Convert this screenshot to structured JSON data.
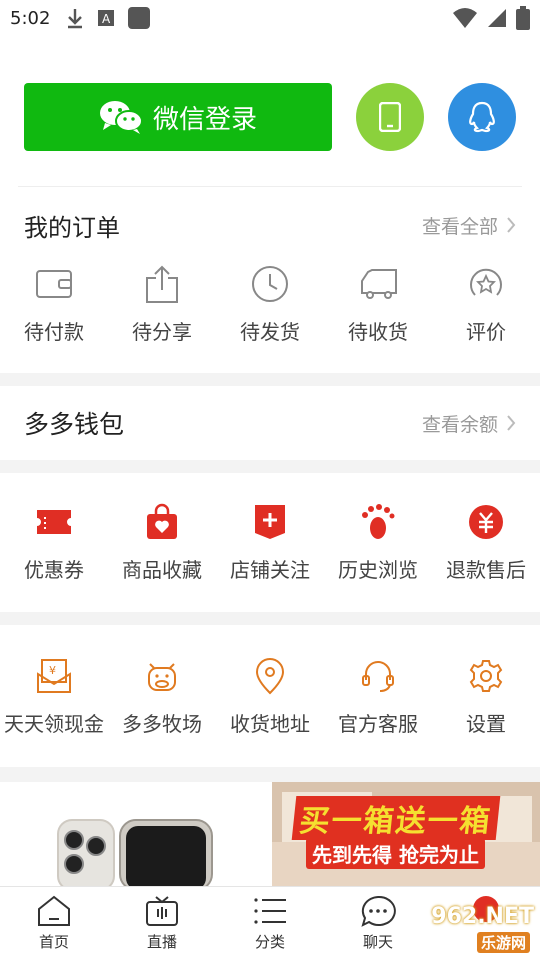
{
  "status": {
    "time": "5:02"
  },
  "login": {
    "wechat_label": "微信登录"
  },
  "orders": {
    "title": "我的订单",
    "link": "查看全部",
    "items": [
      {
        "label": "待付款",
        "icon": "wallet-icon"
      },
      {
        "label": "待分享",
        "icon": "share-icon"
      },
      {
        "label": "待发货",
        "icon": "clock-icon"
      },
      {
        "label": "待收货",
        "icon": "truck-icon"
      },
      {
        "label": "评价",
        "icon": "star-icon"
      }
    ]
  },
  "wallet": {
    "title": "多多钱包",
    "link": "查看余额"
  },
  "services": {
    "items": [
      {
        "label": "优惠券",
        "icon": "coupon-icon"
      },
      {
        "label": "商品收藏",
        "icon": "favorite-bag-icon"
      },
      {
        "label": "店铺关注",
        "icon": "store-follow-icon"
      },
      {
        "label": "历史浏览",
        "icon": "footprint-icon"
      },
      {
        "label": "退款售后",
        "icon": "refund-icon"
      }
    ]
  },
  "tools": {
    "items": [
      {
        "label": "天天领现金",
        "icon": "cash-envelope-icon"
      },
      {
        "label": "多多牧场",
        "icon": "cow-icon"
      },
      {
        "label": "收货地址",
        "icon": "location-icon"
      },
      {
        "label": "官方客服",
        "icon": "headset-icon"
      },
      {
        "label": "设置",
        "icon": "gear-icon"
      }
    ]
  },
  "banner": {
    "promo_title": "买一箱送一箱",
    "promo_sub": "先到先得 抢完为止"
  },
  "nav": {
    "items": [
      {
        "label": "首页",
        "icon": "home-icon"
      },
      {
        "label": "直播",
        "icon": "tv-icon"
      },
      {
        "label": "分类",
        "icon": "list-icon"
      },
      {
        "label": "聊天",
        "icon": "chat-icon"
      },
      {
        "label": "",
        "icon": "profile-icon"
      }
    ]
  },
  "watermark": {
    "brand": "962.NET",
    "sub": "乐游网"
  },
  "colors": {
    "wechat": "#10b910",
    "phone": "#8bd13c",
    "qq": "#2f8fe0",
    "accent_red": "#e02e24",
    "accent_orange": "#e07a20"
  }
}
